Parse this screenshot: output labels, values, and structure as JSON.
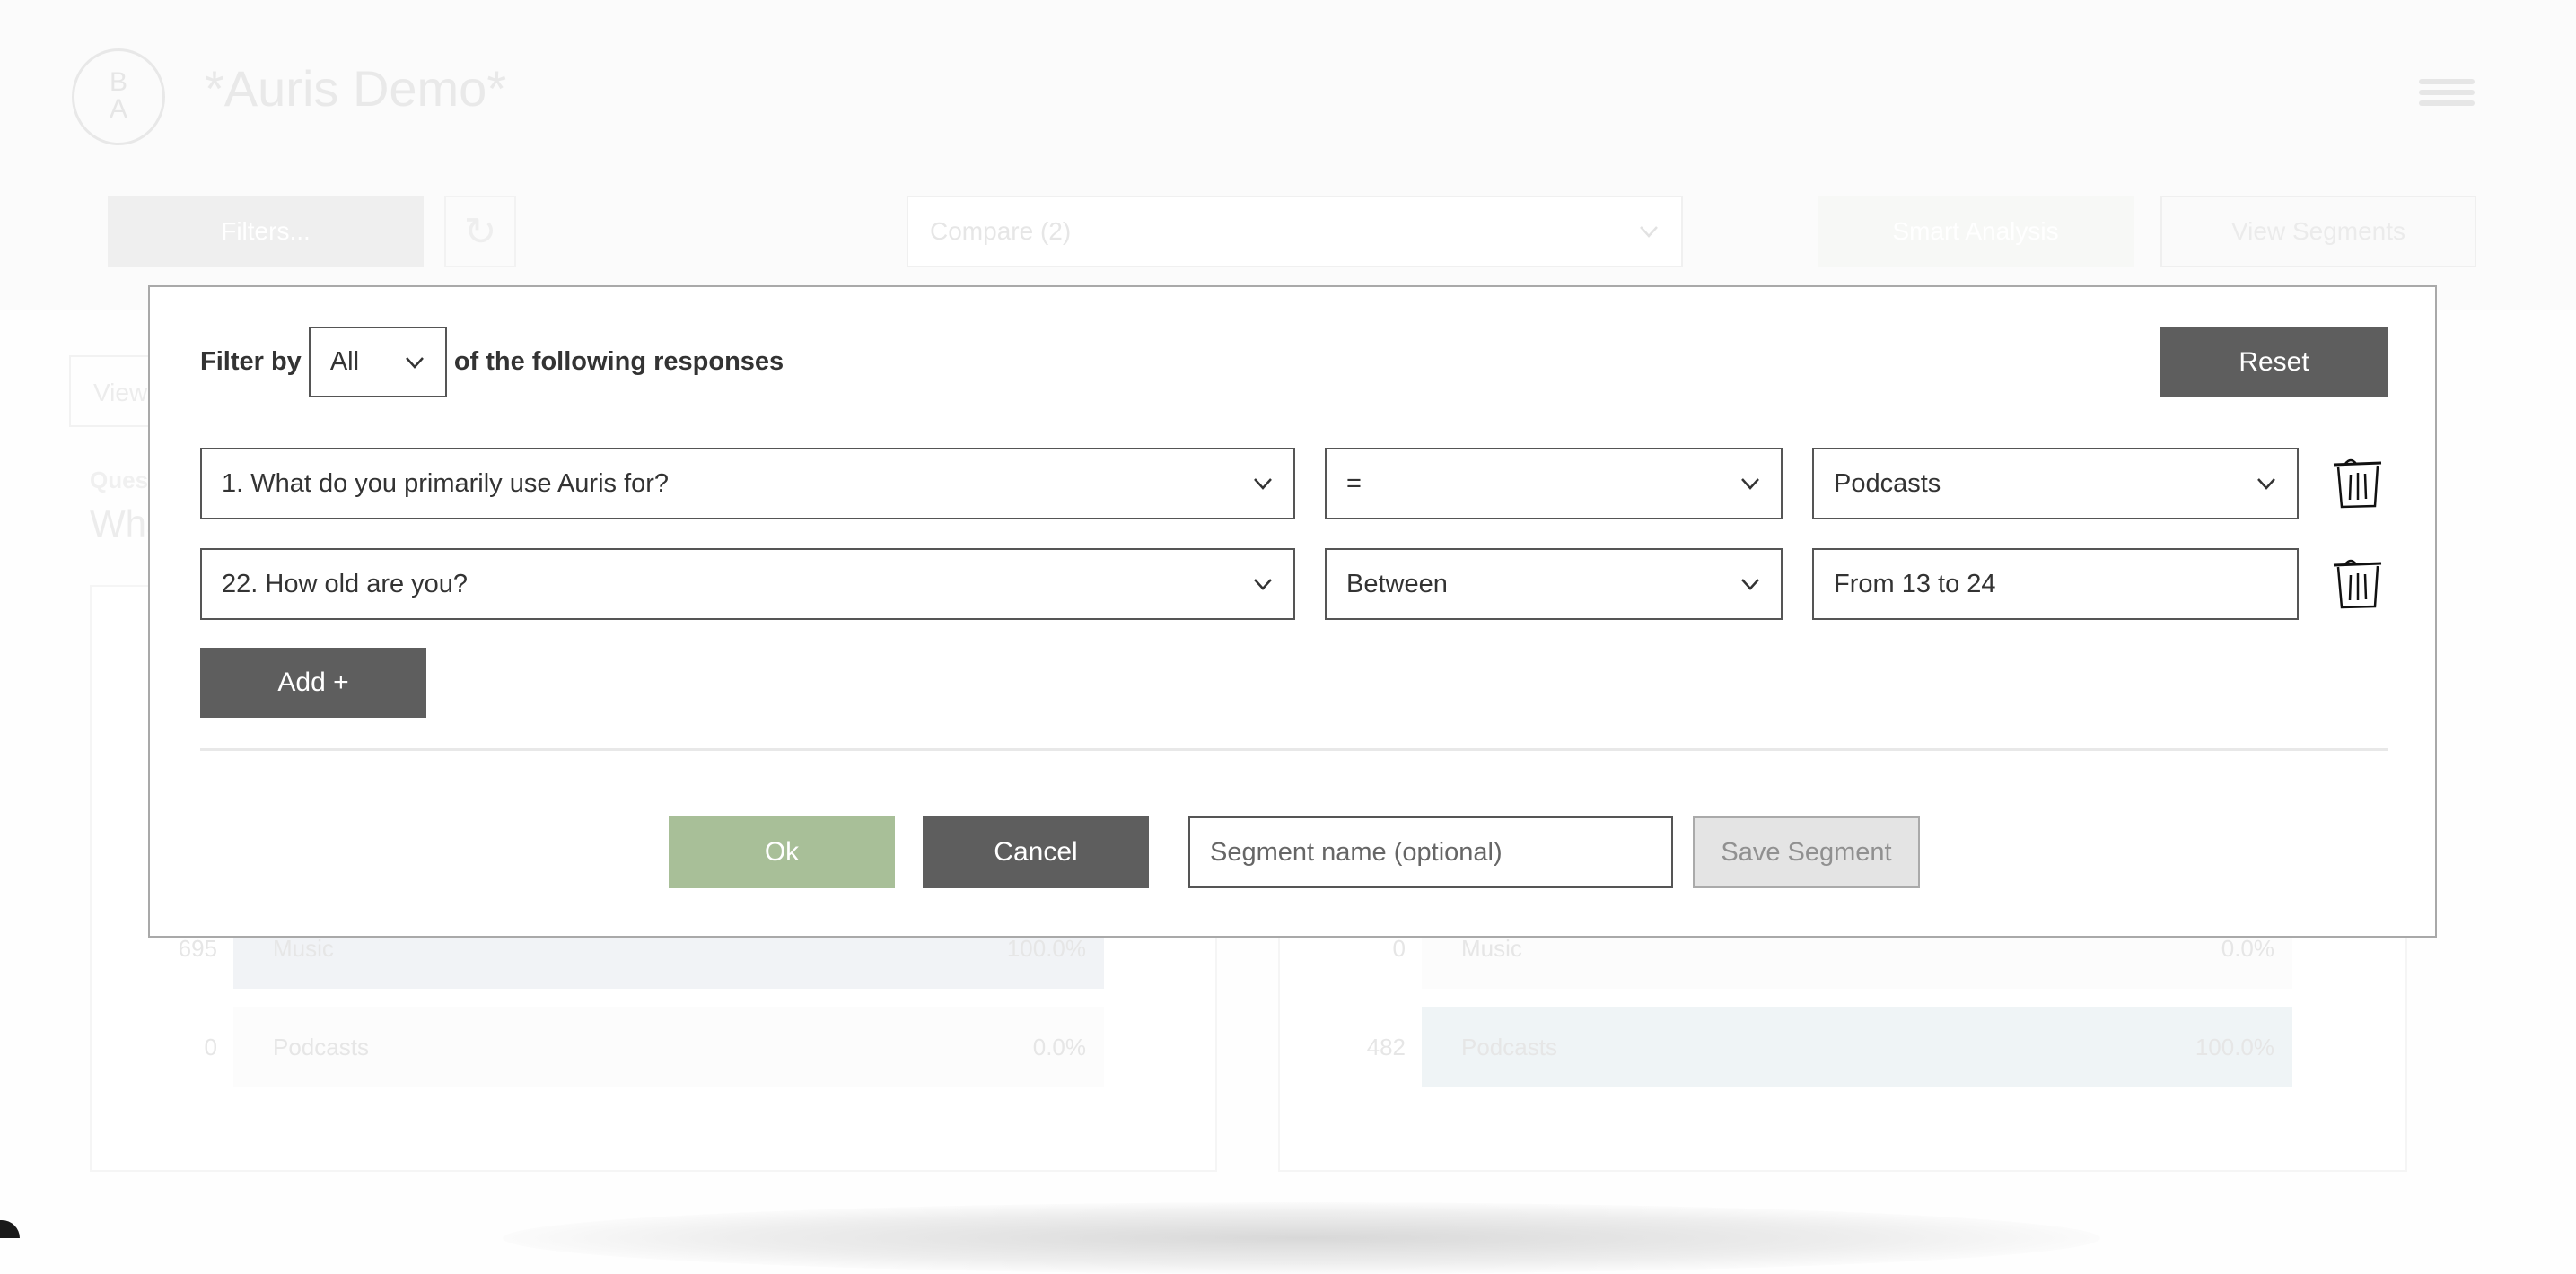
{
  "app": {
    "logo_top": "B",
    "logo_bottom": "A",
    "title": "*Auris Demo*"
  },
  "toolbar": {
    "filters_label": "Filters...",
    "compare_label": "Compare (2)",
    "smart_analysis_label": "Smart Analysis",
    "view_segments_label": "View Segments",
    "view_tab_label": "View"
  },
  "question": {
    "label": "Ques",
    "text": "Wha"
  },
  "panels": [
    {
      "rows": [
        {
          "count": "695",
          "label": "Music",
          "percent": "100.0%",
          "fraction": 1.0
        },
        {
          "count": "0",
          "label": "Podcasts",
          "percent": "0.0%",
          "fraction": 0.0
        }
      ],
      "fill_color": "#f1f3f6"
    },
    {
      "rows": [
        {
          "count": "0",
          "label": "Music",
          "percent": "0.0%",
          "fraction": 0.0
        },
        {
          "count": "482",
          "label": "Podcasts",
          "percent": "100.0%",
          "fraction": 1.0
        }
      ],
      "fill_color": "#eff4f6"
    }
  ],
  "modal": {
    "filter_by_label": "Filter by",
    "match_mode": "All",
    "following_label": "of the following responses",
    "reset_label": "Reset",
    "conditions": [
      {
        "question": "1. What do you primarily use Auris for?",
        "operator": "=",
        "value": "Podcasts",
        "value_is_select": true
      },
      {
        "question": "22. How old are you?",
        "operator": "Between",
        "value": "From 13 to 24",
        "value_is_select": false
      }
    ],
    "add_label": "Add +",
    "ok_label": "Ok",
    "cancel_label": "Cancel",
    "segment_name_placeholder": "Segment name (optional)",
    "segment_name_value": "",
    "save_segment_label": "Save Segment"
  },
  "colors": {
    "ok_green": "#a8bf98",
    "dark_button": "#5e5e5e",
    "save_disabled": "#e4e4e4"
  }
}
